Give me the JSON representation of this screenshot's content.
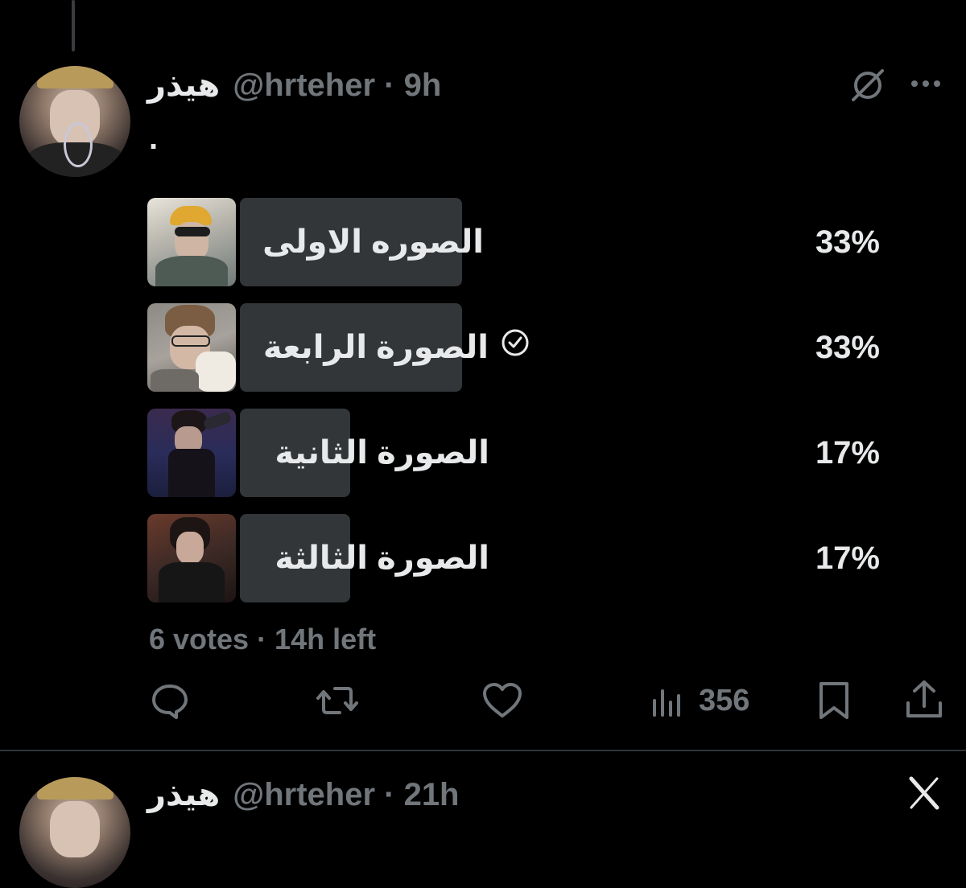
{
  "post": {
    "author_name": "هيذر",
    "handle_time": "@hrteher · 9h",
    "body": "."
  },
  "poll": {
    "options": [
      {
        "label": "الصوره الاولى",
        "percent": "33%",
        "verified": false
      },
      {
        "label": "الصورة الرابعة",
        "percent": "33%",
        "verified": true
      },
      {
        "label": "الصورة الثانية",
        "percent": "17%",
        "verified": false
      },
      {
        "label": "الصورة الثالثة",
        "percent": "17%",
        "verified": false
      }
    ],
    "summary": "6 votes · 14h left"
  },
  "actions": {
    "views": "356"
  },
  "next_post": {
    "author_name": "هيذر",
    "handle_time": "@hrteher · 21h"
  },
  "colors": {
    "background": "#000000",
    "text": "#e7e9ea",
    "muted": "#71767b",
    "bar": "#333639",
    "divider": "#2f3336"
  },
  "icons": [
    "grok-icon",
    "more-icon",
    "reply-icon",
    "repost-icon",
    "like-icon",
    "views-icon",
    "bookmark-icon",
    "share-icon",
    "x-logo-icon",
    "check-circle-icon"
  ]
}
